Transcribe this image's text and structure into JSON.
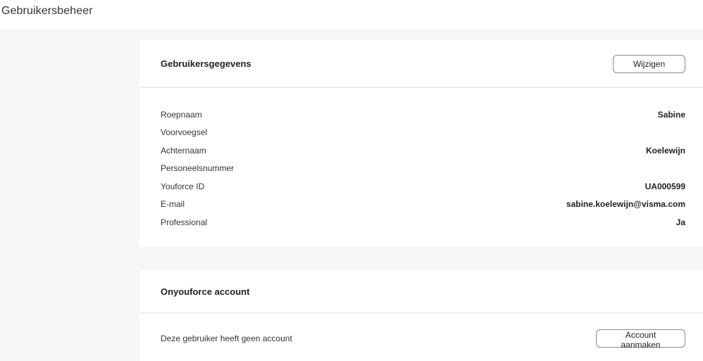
{
  "page": {
    "title": "Gebruikersbeheer"
  },
  "user_details": {
    "title": "Gebruikersgegevens",
    "edit_label": "Wijzigen",
    "fields": [
      {
        "label": "Roepnaam",
        "value": "Sabine"
      },
      {
        "label": "Voorvoegsel",
        "value": ""
      },
      {
        "label": "Achternaam",
        "value": "Koelewijn"
      },
      {
        "label": "Personeelsnummer",
        "value": ""
      },
      {
        "label": "Youforce ID",
        "value": "UA000599"
      },
      {
        "label": "E-mail",
        "value": "sabine.koelewijn@visma.com"
      },
      {
        "label": "Professional",
        "value": "Ja"
      }
    ]
  },
  "account": {
    "title": "Onyouforce account",
    "status_text": "Deze gebruiker heeft geen account",
    "create_label": "Account aanmaken"
  }
}
